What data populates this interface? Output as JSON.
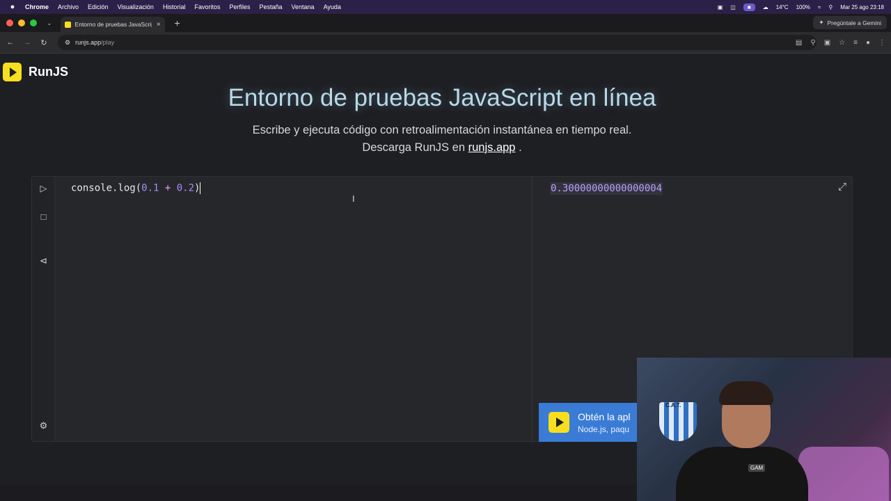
{
  "menubar": {
    "apple": "",
    "items": [
      "Chrome",
      "Archivo",
      "Edición",
      "Visualización",
      "Historial",
      "Favoritos",
      "Perfiles",
      "Pestaña",
      "Ventana",
      "Ayuda"
    ],
    "temperature": "14°C",
    "battery": "100%",
    "datetime": "Mar 25 ago 23:18"
  },
  "browser": {
    "tab_title": "Entorno de pruebas JavaScript",
    "new_tab": "+",
    "gemini_label": "Pregúntale a Gemini",
    "url_host": "runjs.app",
    "url_path": "/play"
  },
  "page": {
    "brand": "RunJS",
    "title": "Entorno de pruebas JavaScript en línea",
    "subtitle_1": "Escribe y ejecuta código con retroalimentación instantánea en tiempo real.",
    "subtitle_2_prefix": "Descarga RunJS en",
    "subtitle_2_link": "runjs.app",
    "subtitle_2_suffix": "."
  },
  "editor": {
    "code_fn": "console.log(",
    "code_a": "0.1",
    "code_op": " + ",
    "code_b": "0.2",
    "code_close": ")",
    "output": "0.30000000000000004"
  },
  "banner": {
    "title": "Obtén la apl",
    "subtitle": "Node.js, paqu"
  },
  "webcam": {
    "badge_text": "C.A.T.",
    "shirt_text": "GAM"
  },
  "colors": {
    "accent_yellow": "#f7df1e",
    "output_purple": "#b9a0ff",
    "banner_blue": "#3a7bd5"
  }
}
